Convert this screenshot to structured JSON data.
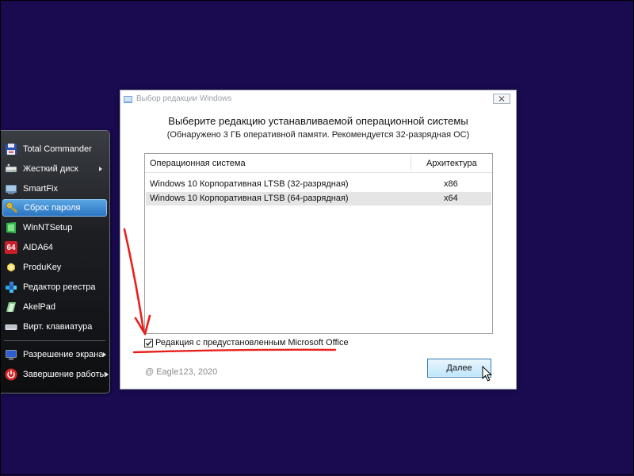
{
  "start_menu": {
    "items": [
      {
        "label": "Total Commander",
        "icon": "floppy-disk-icon",
        "has_submenu": false
      },
      {
        "label": "Жесткий диск",
        "icon": "hard-disk-icon",
        "has_submenu": true
      },
      {
        "label": "SmartFix",
        "icon": "smartfix-icon",
        "has_submenu": false
      },
      {
        "label": "Сброс пароля",
        "icon": "key-icon",
        "has_submenu": false,
        "selected": true
      },
      {
        "label": "WinNTSetup",
        "icon": "winntsetup-icon",
        "has_submenu": false
      },
      {
        "label": "AIDA64",
        "icon": "aida64-icon",
        "icon_text": "64",
        "has_submenu": false
      },
      {
        "label": "ProduKey",
        "icon": "produkey-icon",
        "has_submenu": false
      },
      {
        "label": "Редактор реестра",
        "icon": "registry-editor-icon",
        "has_submenu": false
      },
      {
        "label": "AkelPad",
        "icon": "akelpad-icon",
        "has_submenu": false
      },
      {
        "label": "Вирт. клавиатура",
        "icon": "keyboard-icon",
        "has_submenu": false
      }
    ],
    "bottom_items": [
      {
        "label": "Разрешение экрана",
        "icon": "monitor-icon",
        "has_submenu": true
      },
      {
        "label": "Завершение работы",
        "icon": "power-icon",
        "has_submenu": true
      }
    ]
  },
  "dialog": {
    "title": "Выбор редакции Windows",
    "heading": "Выберите редакцию устанавливаемой операционной системы",
    "subheading": "(Обнаружено 3 ГБ оперативной памяти. Рекомендуется 32-разрядная ОС)",
    "list": {
      "columns": [
        "Операционная система",
        "Архитектура"
      ],
      "rows": [
        {
          "name": "Windows 10 Корпоративная LTSB (32-разрядная)",
          "arch": "x86",
          "selected": false
        },
        {
          "name": "Windows 10 Корпоративная LTSB (64-разрядная)",
          "arch": "x64",
          "selected": true
        }
      ]
    },
    "office_checkbox": {
      "label": "Редакция с предустановленным Microsoft Office",
      "checked": true
    },
    "copyright": "@ Eagle123, 2020",
    "next_button": "Далее"
  },
  "colors": {
    "desktop": "#1a0a50",
    "annotation": "#e8201c",
    "selection": "#2a74c2"
  }
}
